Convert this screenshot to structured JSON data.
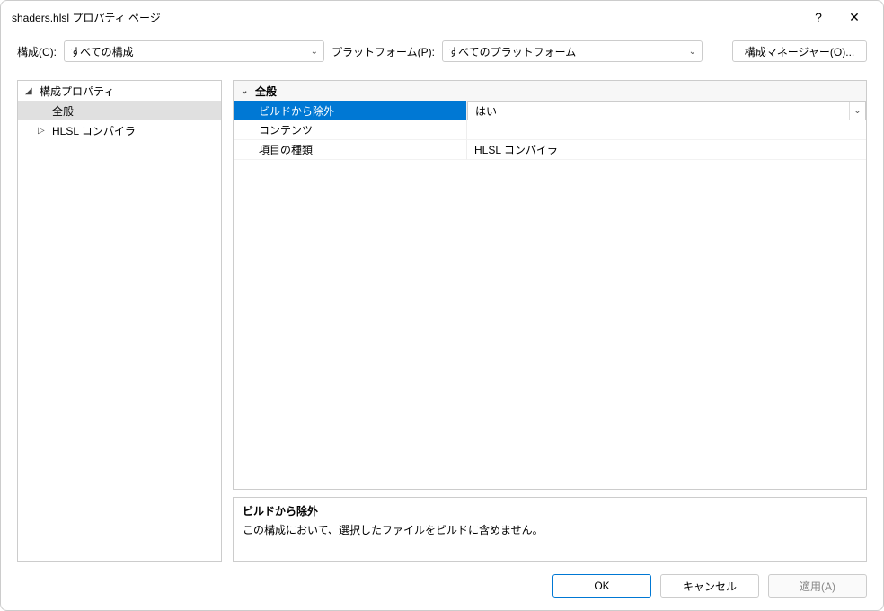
{
  "window": {
    "title": "shaders.hlsl プロパティ ページ",
    "help_symbol": "?",
    "close_symbol": "✕"
  },
  "toolbar": {
    "config_label": "構成(C):",
    "config_value": "すべての構成",
    "platform_label": "プラットフォーム(P):",
    "platform_value": "すべてのプラットフォーム",
    "manager_label": "構成マネージャー(O)..."
  },
  "tree": {
    "root": "構成プロパティ",
    "item_general": "全般",
    "item_hlsl": "HLSL コンパイラ"
  },
  "grid": {
    "category": "全般",
    "rows": [
      {
        "name": "ビルドから除外",
        "value": "はい",
        "selected": true,
        "has_dropdown": true
      },
      {
        "name": "コンテンツ",
        "value": "",
        "selected": false,
        "has_dropdown": false
      },
      {
        "name": "項目の種類",
        "value": "HLSL コンパイラ",
        "selected": false,
        "has_dropdown": false
      }
    ]
  },
  "description": {
    "title": "ビルドから除外",
    "text": "この構成において、選択したファイルをビルドに含めません。"
  },
  "buttons": {
    "ok": "OK",
    "cancel": "キャンセル",
    "apply": "適用(A)"
  }
}
